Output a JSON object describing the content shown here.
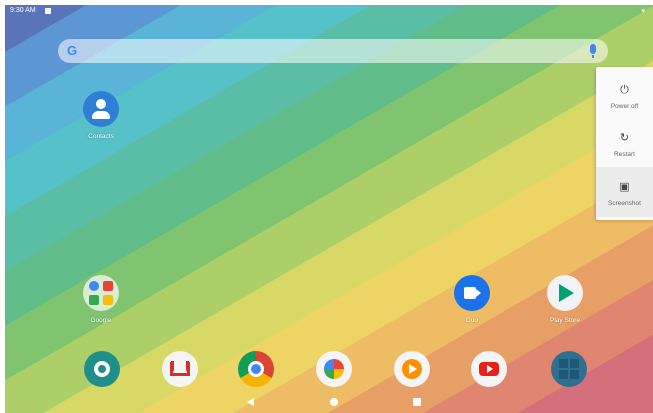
{
  "status_bar": {
    "time": "9:30 AM",
    "right": "▾"
  },
  "search": {
    "logo": "G"
  },
  "apps": [
    {
      "label": "Contacts",
      "icon": "contacts-icon"
    },
    {
      "label": "Google",
      "icon": "google-folder-icon"
    },
    {
      "label": "Duo",
      "icon": "duo-icon"
    },
    {
      "label": "Play Store",
      "icon": "play-store-icon"
    }
  ],
  "dock": [
    {
      "icon": "settings-icon"
    },
    {
      "icon": "gmail-icon"
    },
    {
      "icon": "chrome-icon"
    },
    {
      "icon": "photos-icon"
    },
    {
      "icon": "play-music-icon"
    },
    {
      "icon": "youtube-icon"
    },
    {
      "icon": "calculator-icon"
    }
  ],
  "power_menu": {
    "items": [
      {
        "label": "Power off",
        "icon": "power-icon",
        "glyph": "⏻"
      },
      {
        "label": "Restart",
        "icon": "restart-icon",
        "glyph": "↻"
      },
      {
        "label": "Screenshot",
        "icon": "screenshot-icon",
        "glyph": "▣"
      }
    ]
  }
}
